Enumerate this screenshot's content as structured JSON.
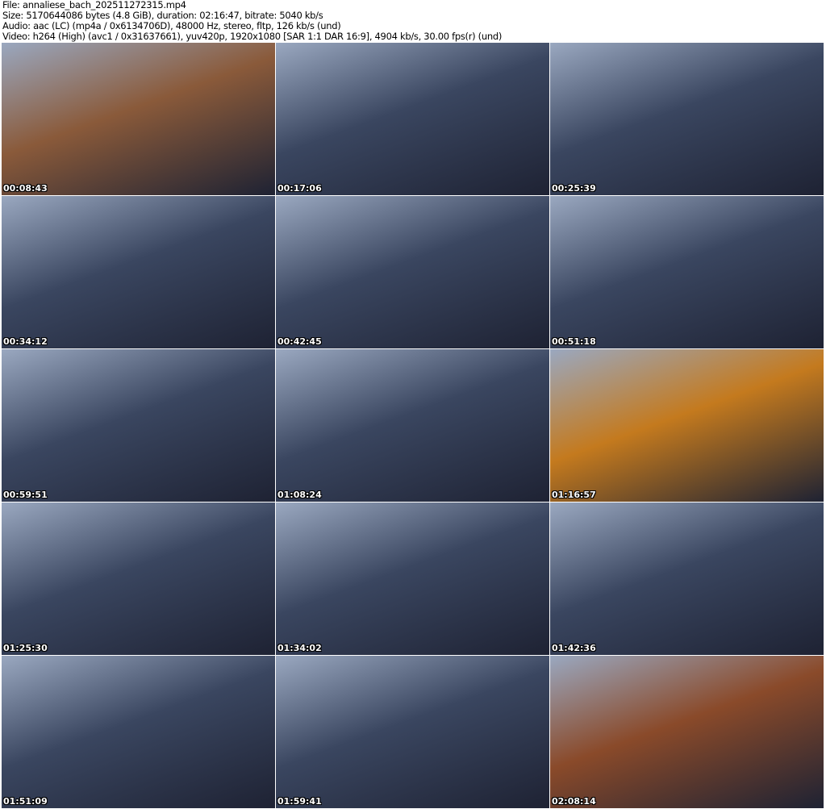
{
  "header": {
    "file": "File: annaliese_bach_202511272315.mp4",
    "size": "Size: 5170644086 bytes (4.8 GiB), duration: 02:16:47, bitrate: 5040 kb/s",
    "audio": "Audio: aac (LC) (mp4a / 0x6134706D), 48000 Hz, stereo, fltp, 126 kb/s (und)",
    "video": "Video: h264 (High) (avc1 / 0x31637661), yuv420p, 1920x1080 [SAR 1:1 DAR 16:9], 4904 kb/s, 30.00 fps(r) (und)"
  },
  "thumbnails": [
    {
      "time": "00:08:43",
      "color": "#8a5a3a"
    },
    {
      "time": "00:17:06",
      "color": "#3a4660"
    },
    {
      "time": "00:25:39",
      "color": "#3a4660"
    },
    {
      "time": "00:34:12",
      "color": "#3a4660"
    },
    {
      "time": "00:42:45",
      "color": "#3a4660"
    },
    {
      "time": "00:51:18",
      "color": "#3a4660"
    },
    {
      "time": "00:59:51",
      "color": "#3a4660"
    },
    {
      "time": "01:08:24",
      "color": "#3a4660"
    },
    {
      "time": "01:16:57",
      "color": "#c47a1e"
    },
    {
      "time": "01:25:30",
      "color": "#3a4660"
    },
    {
      "time": "01:34:02",
      "color": "#3a4660"
    },
    {
      "time": "01:42:36",
      "color": "#3a4660"
    },
    {
      "time": "01:51:09",
      "color": "#3a4660"
    },
    {
      "time": "01:59:41",
      "color": "#3a4660"
    },
    {
      "time": "02:08:14",
      "color": "#8a4a2a"
    }
  ]
}
